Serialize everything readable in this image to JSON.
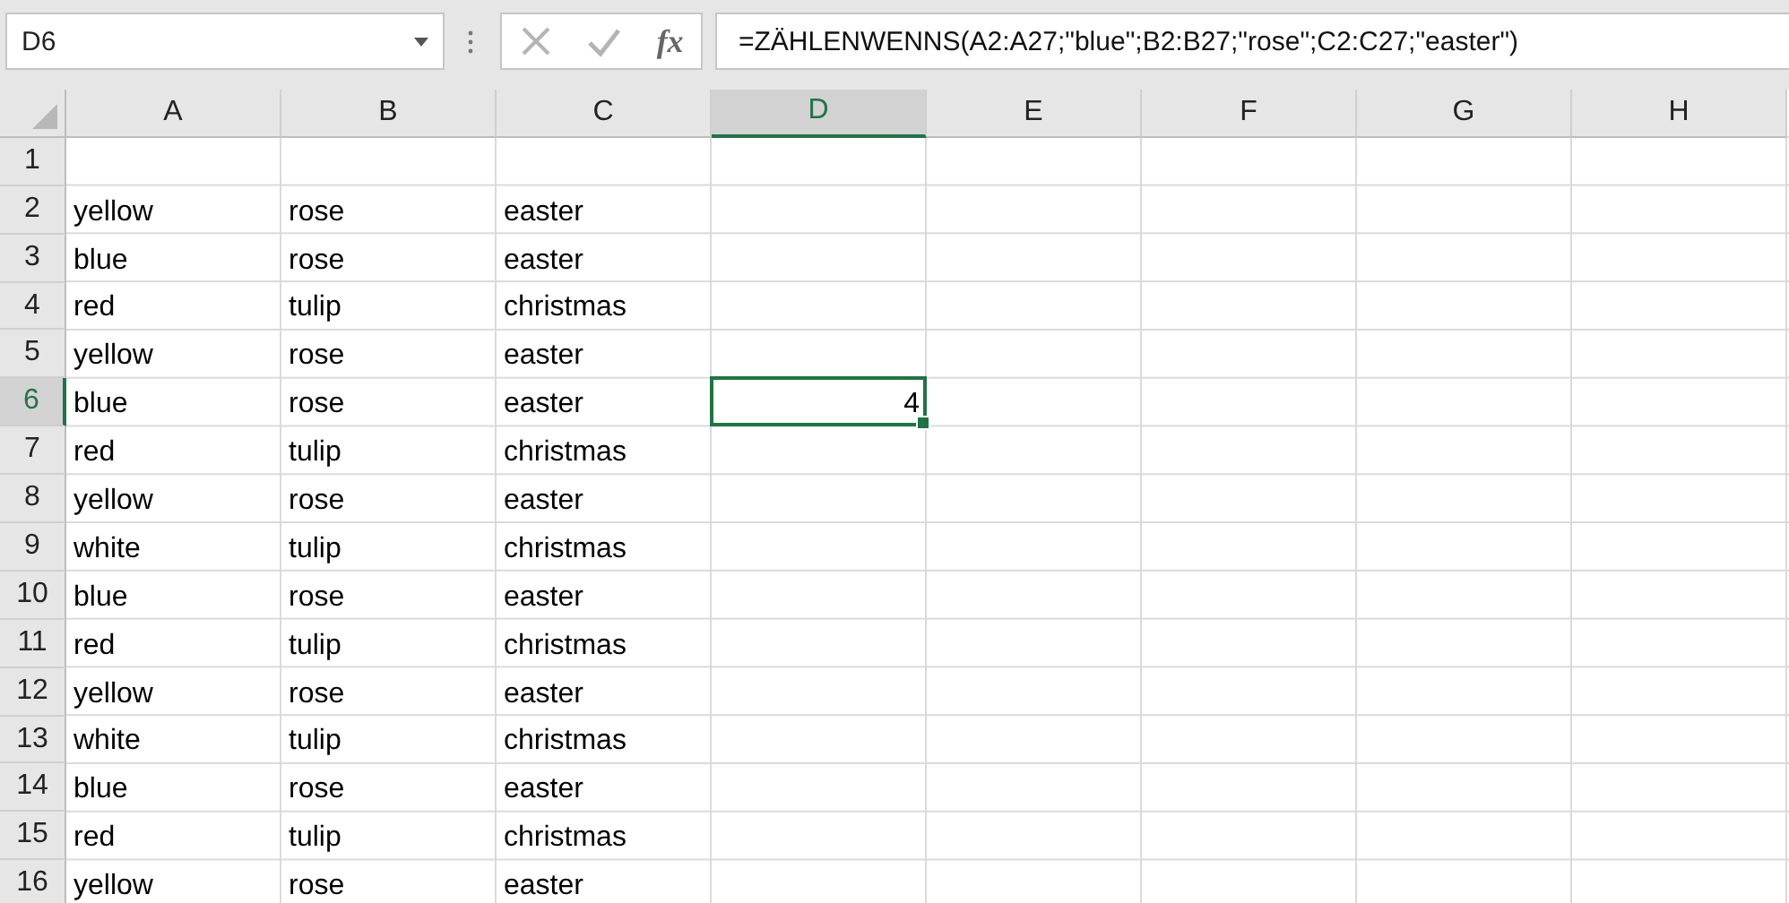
{
  "name_box": {
    "value": "D6"
  },
  "formula_bar": {
    "function_label": "fx",
    "formula": "=ZÄHLENWENNS(A2:A27;\"blue\";B2:B27;\"rose\";C2:C27;\"easter\")"
  },
  "columns": [
    {
      "label": "A",
      "selected": false
    },
    {
      "label": "B",
      "selected": false
    },
    {
      "label": "C",
      "selected": false
    },
    {
      "label": "D",
      "selected": true
    },
    {
      "label": "E",
      "selected": false
    },
    {
      "label": "F",
      "selected": false
    },
    {
      "label": "G",
      "selected": false
    },
    {
      "label": "H",
      "selected": false
    }
  ],
  "rows": [
    {
      "label": "1",
      "selected": false
    },
    {
      "label": "2",
      "selected": false,
      "cells": [
        {
          "text": "yellow",
          "kind": "text"
        },
        {
          "text": "rose",
          "kind": "text"
        },
        {
          "text": "easter",
          "kind": "text"
        }
      ]
    },
    {
      "label": "3",
      "selected": false,
      "cells": [
        {
          "text": "blue",
          "kind": "text"
        },
        {
          "text": "rose",
          "kind": "text"
        },
        {
          "text": "easter",
          "kind": "text"
        }
      ]
    },
    {
      "label": "4",
      "selected": false,
      "cells": [
        {
          "text": "red",
          "kind": "text"
        },
        {
          "text": "tulip",
          "kind": "text"
        },
        {
          "text": "christmas",
          "kind": "text"
        }
      ]
    },
    {
      "label": "5",
      "selected": false,
      "cells": [
        {
          "text": "yellow",
          "kind": "text"
        },
        {
          "text": "rose",
          "kind": "text"
        },
        {
          "text": "easter",
          "kind": "text"
        }
      ]
    },
    {
      "label": "6",
      "selected": true,
      "cells": [
        {
          "text": "blue",
          "kind": "text"
        },
        {
          "text": "rose",
          "kind": "text"
        },
        {
          "text": "easter",
          "kind": "text"
        },
        {
          "text": "4",
          "kind": "number"
        }
      ]
    },
    {
      "label": "7",
      "selected": false,
      "cells": [
        {
          "text": "red",
          "kind": "text"
        },
        {
          "text": "tulip",
          "kind": "text"
        },
        {
          "text": "christmas",
          "kind": "text"
        }
      ]
    },
    {
      "label": "8",
      "selected": false,
      "cells": [
        {
          "text": "yellow",
          "kind": "text"
        },
        {
          "text": "rose",
          "kind": "text"
        },
        {
          "text": "easter",
          "kind": "text"
        }
      ]
    },
    {
      "label": "9",
      "selected": false,
      "cells": [
        {
          "text": "white",
          "kind": "text"
        },
        {
          "text": "tulip",
          "kind": "text"
        },
        {
          "text": "christmas",
          "kind": "text"
        }
      ]
    },
    {
      "label": "10",
      "selected": false,
      "cells": [
        {
          "text": "blue",
          "kind": "text"
        },
        {
          "text": "rose",
          "kind": "text"
        },
        {
          "text": "easter",
          "kind": "text"
        }
      ]
    },
    {
      "label": "11",
      "selected": false,
      "cells": [
        {
          "text": "red",
          "kind": "text"
        },
        {
          "text": "tulip",
          "kind": "text"
        },
        {
          "text": "christmas",
          "kind": "text"
        }
      ]
    },
    {
      "label": "12",
      "selected": false,
      "cells": [
        {
          "text": "yellow",
          "kind": "text"
        },
        {
          "text": "rose",
          "kind": "text"
        },
        {
          "text": "easter",
          "kind": "text"
        }
      ]
    },
    {
      "label": "13",
      "selected": false,
      "cells": [
        {
          "text": "white",
          "kind": "text"
        },
        {
          "text": "tulip",
          "kind": "text"
        },
        {
          "text": "christmas",
          "kind": "text"
        }
      ]
    },
    {
      "label": "14",
      "selected": false,
      "cells": [
        {
          "text": "blue",
          "kind": "text"
        },
        {
          "text": "rose",
          "kind": "text"
        },
        {
          "text": "easter",
          "kind": "text"
        }
      ]
    },
    {
      "label": "15",
      "selected": false,
      "cells": [
        {
          "text": "red",
          "kind": "text"
        },
        {
          "text": "tulip",
          "kind": "text"
        },
        {
          "text": "christmas",
          "kind": "text"
        }
      ]
    },
    {
      "label": "16",
      "selected": false,
      "cells": [
        {
          "text": "yellow",
          "kind": "text"
        },
        {
          "text": "rose",
          "kind": "text"
        },
        {
          "text": "easter",
          "kind": "text"
        }
      ]
    }
  ]
}
